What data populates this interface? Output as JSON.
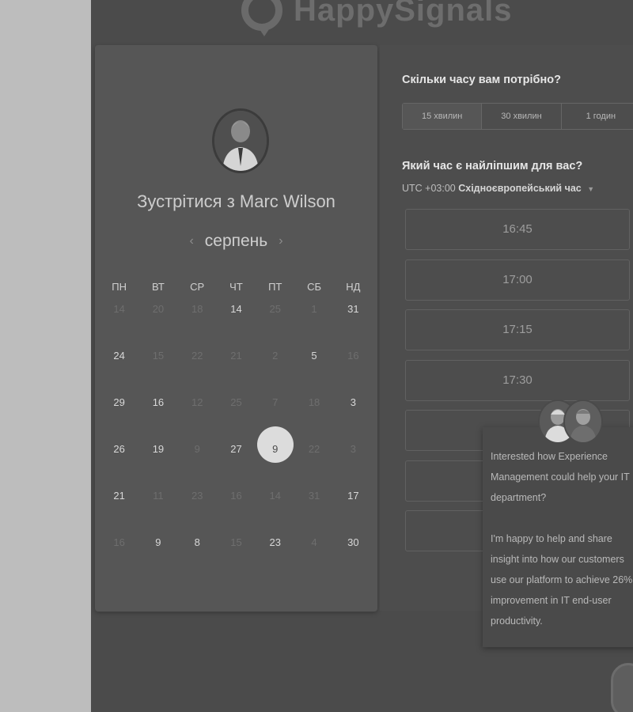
{
  "brand": {
    "name": "HappySignals"
  },
  "calendar": {
    "title_prefix": "Зустрітися з",
    "host_name": "Marc Wilson",
    "month": "серпень",
    "prev_icon": "chevron-left-icon",
    "next_icon": "chevron-right-icon",
    "weekdays": [
      "ПН",
      "ВТ",
      "СР",
      "ЧТ",
      "ПТ",
      "СБ",
      "НД"
    ],
    "weeks": [
      [
        {
          "d": "14",
          "a": false
        },
        {
          "d": "20",
          "a": false
        },
        {
          "d": "18",
          "a": false
        },
        {
          "d": "14",
          "a": true
        },
        {
          "d": "25",
          "a": false
        },
        {
          "d": "1",
          "a": false
        },
        {
          "d": "31",
          "a": true
        }
      ],
      [
        {
          "d": "24",
          "a": true
        },
        {
          "d": "15",
          "a": false
        },
        {
          "d": "22",
          "a": false
        },
        {
          "d": "21",
          "a": false
        },
        {
          "d": "2",
          "a": false
        },
        {
          "d": "5",
          "a": true
        },
        {
          "d": "16",
          "a": false
        }
      ],
      [
        {
          "d": "29",
          "a": true
        },
        {
          "d": "16",
          "a": true
        },
        {
          "d": "12",
          "a": false
        },
        {
          "d": "25",
          "a": false
        },
        {
          "d": "7",
          "a": false
        },
        {
          "d": "18",
          "a": false
        },
        {
          "d": "3",
          "a": true
        }
      ],
      [
        {
          "d": "26",
          "a": true
        },
        {
          "d": "19",
          "a": true
        },
        {
          "d": "9",
          "a": false
        },
        {
          "d": "27",
          "a": true
        },
        {
          "d": "9",
          "a": true,
          "s": true
        },
        {
          "d": "22",
          "a": false
        },
        {
          "d": "3",
          "a": false
        }
      ],
      [
        {
          "d": "21",
          "a": true
        },
        {
          "d": "11",
          "a": false
        },
        {
          "d": "23",
          "a": false
        },
        {
          "d": "16",
          "a": false
        },
        {
          "d": "14",
          "a": false
        },
        {
          "d": "31",
          "a": false
        },
        {
          "d": "17",
          "a": true
        }
      ],
      [
        {
          "d": "16",
          "a": false
        },
        {
          "d": "9",
          "a": true
        },
        {
          "d": "8",
          "a": true
        },
        {
          "d": "15",
          "a": false
        },
        {
          "d": "23",
          "a": true
        },
        {
          "d": "4",
          "a": false
        },
        {
          "d": "30",
          "a": true
        }
      ]
    ]
  },
  "booking": {
    "duration_question": "Скільки часу вам потрібно?",
    "durations": [
      "15 хвилин",
      "30 хвилин",
      "1 годин"
    ],
    "time_question": "Який час є найліпшим для вас?",
    "timezone_prefix": "UTC +03:00",
    "timezone_name": "Східноєвропейський час",
    "slots": [
      "16:45",
      "17:00",
      "17:15",
      "17:30",
      "",
      "",
      ""
    ]
  },
  "chat": {
    "message_1": "Interested how Experience Management could help your IT department?",
    "message_2": "I'm happy to help and share insight into how our customers use our platform to achieve 26% improvement in IT end-user productivity."
  },
  "colors": {
    "page_bg": "#bdbdbd",
    "stage_bg": "#4b4b4b",
    "panel_bg": "#565656",
    "selected_day": "#dcdcdc"
  }
}
